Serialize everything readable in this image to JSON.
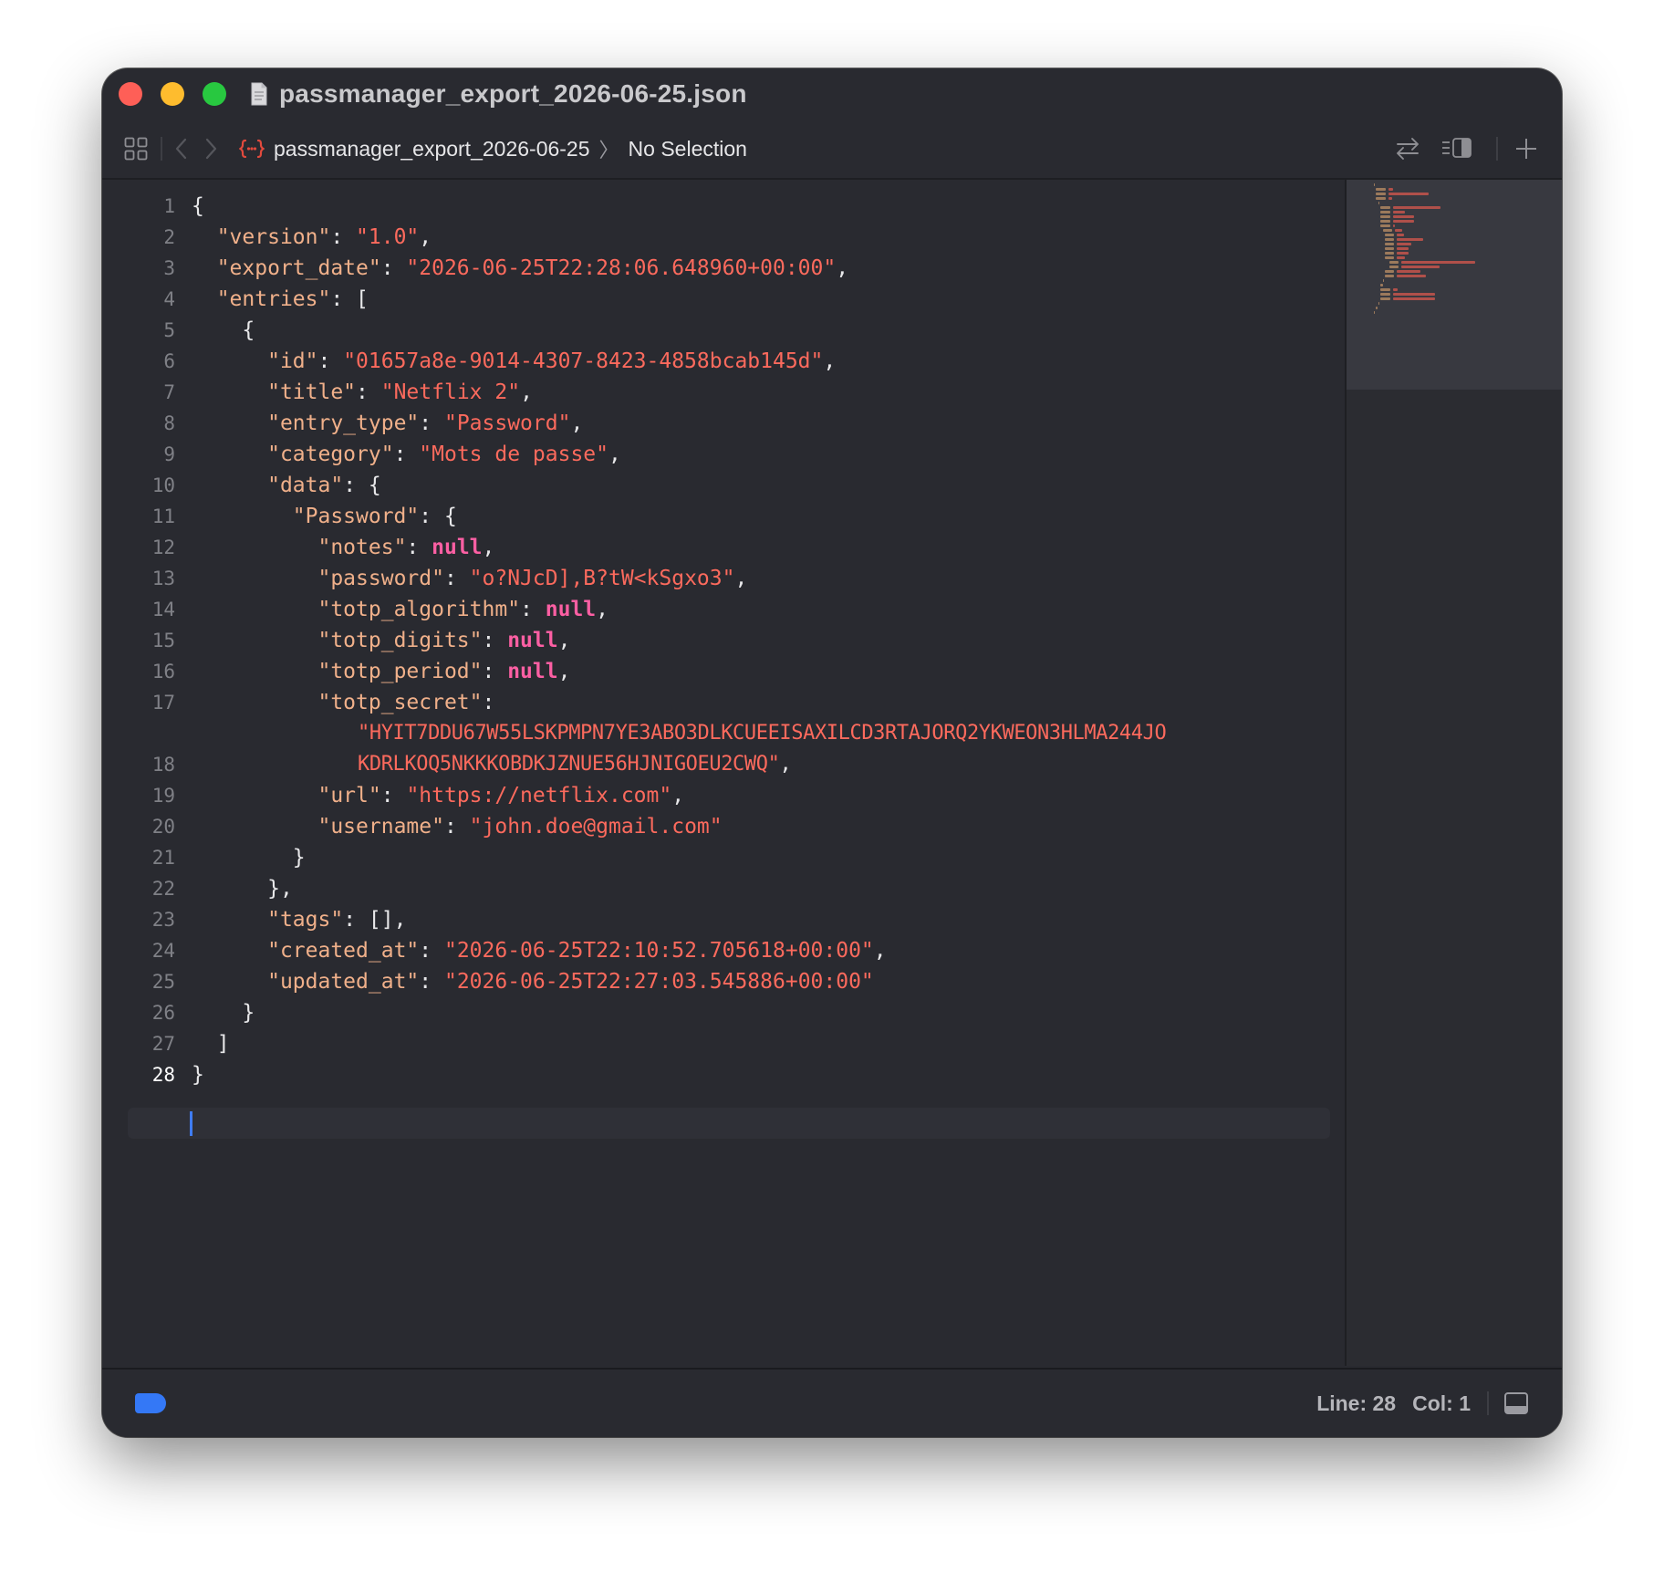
{
  "window": {
    "title": "passmanager_export_2026-06-25.json"
  },
  "navbar": {
    "breadcrumb_file": "passmanager_export_2026-06-25",
    "breadcrumb_selection": "No Selection"
  },
  "editor": {
    "current_line": 28,
    "lines": [
      {
        "num": "1"
      },
      {
        "num": "2"
      },
      {
        "num": "3"
      },
      {
        "num": "4"
      },
      {
        "num": "5"
      },
      {
        "num": "6"
      },
      {
        "num": "7"
      },
      {
        "num": "8"
      },
      {
        "num": "9"
      },
      {
        "num": "10"
      },
      {
        "num": "11"
      },
      {
        "num": "12"
      },
      {
        "num": "13"
      },
      {
        "num": "14"
      },
      {
        "num": "15"
      },
      {
        "num": "16"
      },
      {
        "num": "17"
      },
      {
        "num": ""
      },
      {
        "num": "18"
      },
      {
        "num": "19"
      },
      {
        "num": "20"
      },
      {
        "num": "21"
      },
      {
        "num": "22"
      },
      {
        "num": "23"
      },
      {
        "num": "24"
      },
      {
        "num": "25"
      },
      {
        "num": "26"
      },
      {
        "num": "27"
      },
      {
        "num": "28"
      }
    ],
    "code": {
      "l1_open": "{",
      "l2_key": "\"version\"",
      "l2_val": "\"1.0\"",
      "l3_key": "\"export_date\"",
      "l3_val": "\"2026-06-25T22:28:06.648960+00:00\"",
      "l4_key": "\"entries\"",
      "l4_tail": ": [",
      "l5_open": "{",
      "l6_key": "\"id\"",
      "l6_val": "\"01657a8e-9014-4307-8423-4858bcab145d\"",
      "l7_key": "\"title\"",
      "l7_val": "\"Netflix 2\"",
      "l8_key": "\"entry_type\"",
      "l8_val": "\"Password\"",
      "l9_key": "\"category\"",
      "l9_val": "\"Mots de passe\"",
      "l10_key": "\"data\"",
      "l10_tail": ": {",
      "l11_key": "\"Password\"",
      "l11_tail": ": {",
      "l12_key": "\"notes\"",
      "l12_val": "null",
      "l13_key": "\"password\"",
      "l13_val": "\"o?NJcD],B?tW<kSgxo3\"",
      "l14_key": "\"totp_algorithm\"",
      "l14_val": "null",
      "l15_key": "\"totp_digits\"",
      "l15_val": "null",
      "l16_key": "\"totp_period\"",
      "l16_val": "null",
      "l17_key": "\"totp_secret\"",
      "l17_val_a": "\"HYIT7DDU67W55LSKPMPN7YE3ABO3DLKCUEEISAXILCD3RTAJORQ2YKWEON3HLMA244JO",
      "l17_val_b": "KDRLKOQ5NKKKOBDKJZNUE56HJNIGOEU2CWQ\"",
      "l18_key": "\"url\"",
      "l18_val": "\"https://netflix.com\"",
      "l19_key": "\"username\"",
      "l19_val": "\"john.doe@gmail.com\"",
      "l20_close": "}",
      "l21_close": "},",
      "l22_key": "\"tags\"",
      "l22_tail": ": [],",
      "l23_key": "\"created_at\"",
      "l23_val": "\"2026-06-25T22:10:52.705618+00:00\"",
      "l24_key": "\"updated_at\"",
      "l24_val": "\"2026-06-25T22:27:03.545886+00:00\"",
      "l25_close": "}",
      "l26_close": "]",
      "l27_close": "}"
    }
  },
  "status": {
    "line": "Line: 28",
    "col": "Col: 1"
  },
  "colors": {
    "background": "#292a30",
    "key": "#f0b08a",
    "string": "#fc6a5d",
    "keyword_null": "#fc5fa3",
    "caret": "#3f7cf2",
    "badge": "#3478f6"
  },
  "icons": {
    "title_doc": "document-icon",
    "grid": "grid-icon",
    "back": "chevron-left-icon",
    "forward": "chevron-right-icon",
    "json_file": "json-braces-icon",
    "swap": "arrows-swap-icon",
    "inspector": "inspector-toggle-icon",
    "add": "plus-icon",
    "status_badge": "tag-icon",
    "panel_toggle": "bottom-panel-icon"
  }
}
